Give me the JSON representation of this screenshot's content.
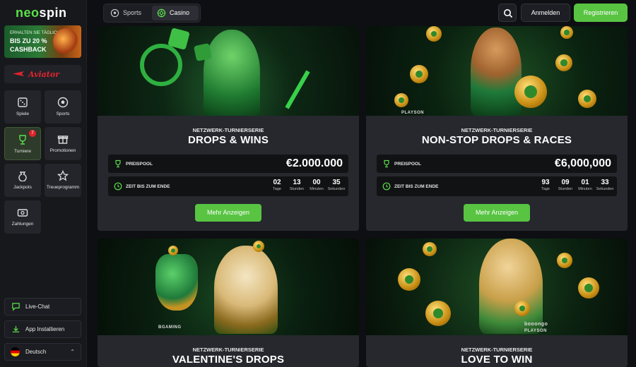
{
  "logo": {
    "part1": "neo",
    "part2": "spin"
  },
  "promo": {
    "line1": "ERHALTEN SIE TÄGLICH",
    "line2": "BIS ZU 20 %",
    "line3": "CASHBACK"
  },
  "aviator": {
    "label": "Aviator"
  },
  "nav": [
    {
      "label": "Spiele",
      "icon": "dice-icon"
    },
    {
      "label": "Sports",
      "icon": "soccer-ball-icon"
    },
    {
      "label": "Turniere",
      "icon": "trophy-icon",
      "badge": "7"
    },
    {
      "label": "Promotionen",
      "icon": "gift-icon"
    },
    {
      "label": "Jackpots",
      "icon": "money-bag-icon"
    },
    {
      "label": "Treueprogramm",
      "icon": "star-icon"
    },
    {
      "label": "Zahlungen",
      "icon": "payment-icon"
    }
  ],
  "sidebar_bottom": {
    "livechat": "Live-Chat",
    "install": "App Installieren",
    "language": "Deutsch"
  },
  "topbar": {
    "tab_sports": "Sports",
    "tab_casino": "Casino",
    "login": "Anmelden",
    "register": "Registrieren"
  },
  "colors": {
    "accent": "#58c442",
    "background": "#0e0f12",
    "card": "#26282e"
  },
  "cards": [
    {
      "subtitle": "NETZWERK-TURNIERSERIE",
      "title": "DROPS & WINS",
      "pool_label": "PREISPOOL",
      "pool_amount": "€2.000.000",
      "timer_label": "ZEIT BIS ZUM ENDE",
      "countdown": [
        {
          "value": "02",
          "unit": "Tage"
        },
        {
          "value": "13",
          "unit": "Stunden"
        },
        {
          "value": "00",
          "unit": "Minuten"
        },
        {
          "value": "35",
          "unit": "Sekunden"
        }
      ],
      "button": "Mehr Anzeigen"
    },
    {
      "subtitle": "NETZWERK-TURNIERSERIE",
      "title": "NON-STOP DROPS & RACES",
      "pool_label": "PREISPOOL",
      "pool_amount": "€6,000,000",
      "timer_label": "ZEIT BIS ZUM ENDE",
      "countdown": [
        {
          "value": "93",
          "unit": "Tage"
        },
        {
          "value": "09",
          "unit": "Stunden"
        },
        {
          "value": "01",
          "unit": "Minuten"
        },
        {
          "value": "33",
          "unit": "Sekunden"
        }
      ],
      "button": "Mehr Anzeigen",
      "provider": "PLAYSON"
    },
    {
      "subtitle": "NETZWERK-TURNIERSERIE",
      "title": "VALENTINE'S DROPS",
      "provider": "BGAMING"
    },
    {
      "subtitle": "NETZWERK-TURNIERSERIE",
      "title": "LOVE TO WIN",
      "provider": "booongo",
      "provider2": "PLAYSON"
    }
  ]
}
